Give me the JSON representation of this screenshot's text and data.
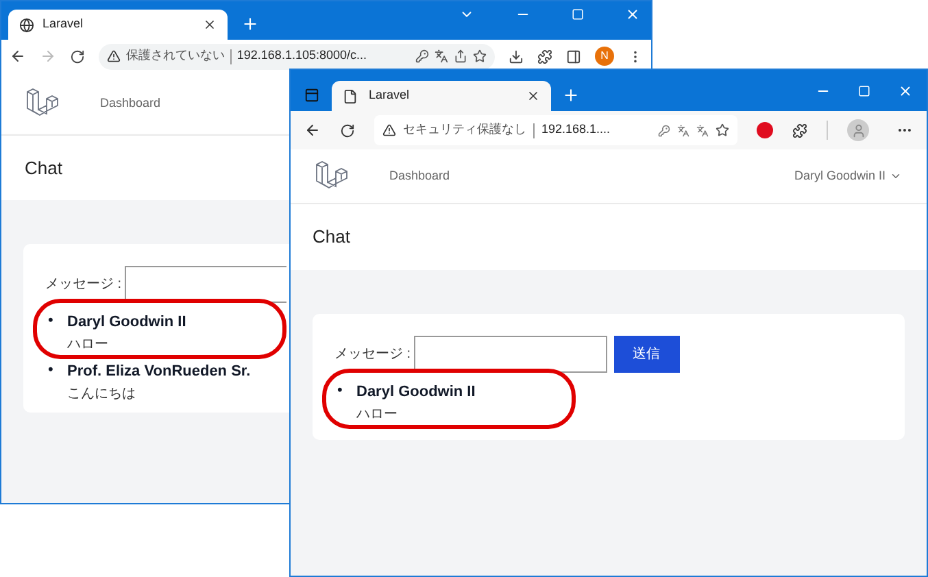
{
  "windows": [
    {
      "kind": "chrome",
      "tab_title": "Laravel",
      "address_warning": "保護されていない",
      "address": "192.168.1.105:8000/c...",
      "avatar_letter": "N",
      "nav_link": "Dashboard",
      "page_title": "Chat",
      "form_label": "メッセージ :",
      "messages": [
        {
          "bullet": "•",
          "author": "Daryl Goodwin II",
          "text": "ハロー",
          "highlighted": true
        },
        {
          "bullet": "•",
          "author": "Prof. Eliza VonRueden Sr.",
          "text": "こんにちは",
          "highlighted": false
        }
      ]
    },
    {
      "kind": "edge",
      "tab_title": "Laravel",
      "address_warning": "セキュリティ保護なし",
      "address": "192.168.1....",
      "nav_link": "Dashboard",
      "user_name": "Daryl Goodwin II",
      "page_title": "Chat",
      "form_label": "メッセージ :",
      "send_button": "送信",
      "messages": [
        {
          "bullet": "•",
          "author": "Daryl Goodwin II",
          "text": "ハロー",
          "highlighted": true
        }
      ]
    }
  ]
}
